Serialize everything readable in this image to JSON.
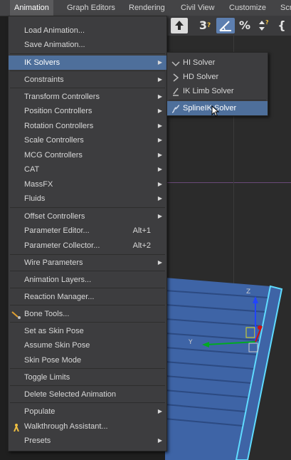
{
  "menubar": {
    "items": [
      {
        "label": "Animation",
        "active": true
      },
      {
        "label": "Graph Editors"
      },
      {
        "label": "Rendering"
      },
      {
        "label": "Civil View"
      },
      {
        "label": "Customize"
      },
      {
        "label": "Scr"
      }
    ]
  },
  "toolbar": {
    "snap_value": "3",
    "percent_label": "%",
    "bracket": "{"
  },
  "animation_menu": {
    "items": [
      {
        "label": "Load Animation..."
      },
      {
        "label": "Save Animation..."
      },
      {
        "label": "IK Solvers",
        "submenu": true,
        "highlighted": true
      },
      {
        "label": "Constraints",
        "submenu": true
      },
      {
        "label": "Transform Controllers",
        "submenu": true
      },
      {
        "label": "Position Controllers",
        "submenu": true
      },
      {
        "label": "Rotation Controllers",
        "submenu": true
      },
      {
        "label": "Scale Controllers",
        "submenu": true
      },
      {
        "label": "MCG Controllers",
        "submenu": true
      },
      {
        "label": "CAT",
        "submenu": true
      },
      {
        "label": "MassFX",
        "submenu": true
      },
      {
        "label": "Fluids",
        "submenu": true
      },
      {
        "label": "Offset Controllers",
        "submenu": true
      },
      {
        "label": "Parameter Editor...",
        "shortcut": "Alt+1"
      },
      {
        "label": "Parameter Collector...",
        "shortcut": "Alt+2"
      },
      {
        "label": "Wire Parameters",
        "submenu": true
      },
      {
        "label": "Animation Layers..."
      },
      {
        "label": "Reaction Manager..."
      },
      {
        "label": "Bone Tools...",
        "icon": "bone-tools-icon"
      },
      {
        "label": "Set as Skin Pose"
      },
      {
        "label": "Assume Skin Pose"
      },
      {
        "label": "Skin Pose Mode"
      },
      {
        "label": "Toggle Limits"
      },
      {
        "label": "Delete Selected Animation"
      },
      {
        "label": "Populate",
        "submenu": true
      },
      {
        "label": "Walkthrough Assistant...",
        "icon": "walkthrough-icon"
      },
      {
        "label": "Presets",
        "submenu": true
      }
    ]
  },
  "ik_submenu": {
    "items": [
      {
        "label": "HI Solver",
        "icon": "hi-solver-icon"
      },
      {
        "label": "HD Solver",
        "icon": "hd-solver-icon"
      },
      {
        "label": "IK Limb Solver",
        "icon": "ik-limb-solver-icon"
      },
      {
        "label": "SplineIK Solver",
        "icon": "splineik-solver-icon",
        "highlighted": true
      }
    ]
  },
  "colors": {
    "menu_bg": "#3d3d3f",
    "highlight": "#4e6f9b",
    "text": "#d8d8d8",
    "menubar_bg": "#444446",
    "viewport_bg": "#2b2b2b",
    "deck_blue": "#3e64a6",
    "selection_cyan": "#5fdcff"
  }
}
